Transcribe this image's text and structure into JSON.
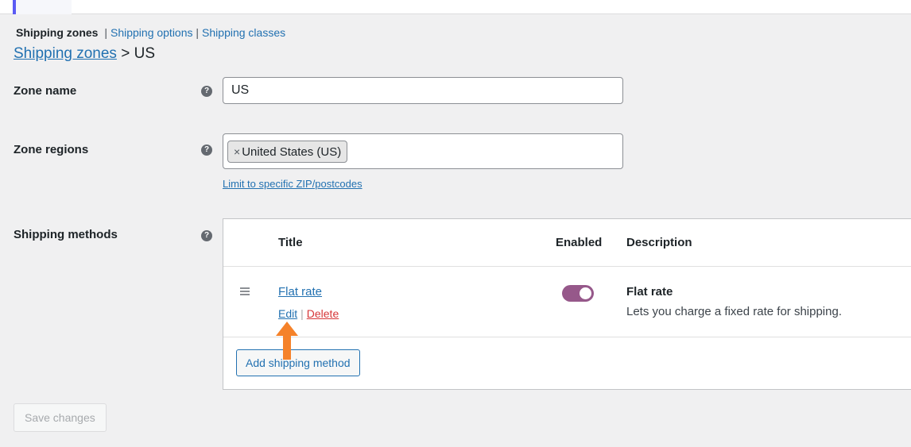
{
  "tabs": {
    "current": "Shipping zones",
    "separator": "|",
    "links": [
      "Shipping options",
      "Shipping classes"
    ]
  },
  "breadcrumb": {
    "parent": "Shipping zones",
    "separator": ">",
    "current": "US"
  },
  "form": {
    "zone_name_label": "Zone name",
    "zone_name_value": "US",
    "zone_regions_label": "Zone regions",
    "region_chip_remove": "×",
    "region_chip": "United States (US)",
    "limit_link": "Limit to specific ZIP/postcodes",
    "shipping_methods_label": "Shipping methods",
    "help_glyph": "?"
  },
  "methods_table": {
    "headers": {
      "title": "Title",
      "enabled": "Enabled",
      "description": "Description"
    },
    "rows": [
      {
        "title": "Flat rate",
        "edit": "Edit",
        "separator": "|",
        "delete": "Delete",
        "enabled": true,
        "description_title": "Flat rate",
        "description_text": "Lets you charge a fixed rate for shipping."
      }
    ],
    "add_button": "Add shipping method"
  },
  "save_button": "Save changes",
  "colors": {
    "link": "#2271b1",
    "toggle_on": "#96588a",
    "delete": "#d63638",
    "arrow": "#f5822a"
  }
}
